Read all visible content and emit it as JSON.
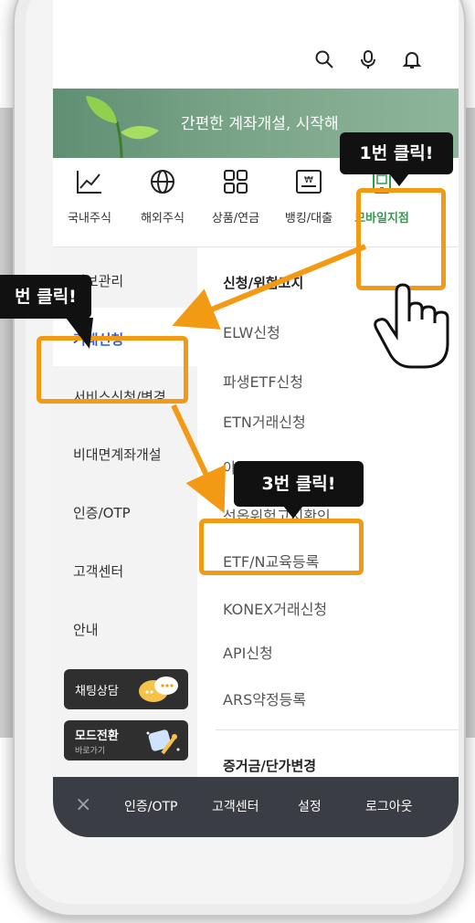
{
  "banner": {
    "text": "간편한 계좌개설, 시작해"
  },
  "top_icons": [
    "search-icon",
    "microphone-icon",
    "bell-icon"
  ],
  "menu": [
    {
      "label": "국내주식",
      "icon": "trend-chart-icon",
      "active": false
    },
    {
      "label": "해외주식",
      "icon": "globe-icon",
      "active": false
    },
    {
      "label": "상품/연금",
      "icon": "grid-icon",
      "active": false
    },
    {
      "label": "뱅킹/대출",
      "icon": "won-card-icon",
      "active": false
    },
    {
      "label": "모바일지점",
      "icon": "mobile-icon",
      "active": true
    }
  ],
  "left_nav": {
    "items": [
      "정보관리",
      "거래신청",
      "서비스신청/변경",
      "비대면계좌개설",
      "인증/OTP",
      "고객센터",
      "안내"
    ],
    "selected": "거래신청",
    "chat_button": "채팅상담",
    "mode_button": {
      "label": "모드전환",
      "sub": "바로가기"
    }
  },
  "right_list": {
    "header": "신청/위험고지",
    "items": [
      "ELW신청",
      "파생ETF신청",
      "ETN거래신청",
      "야",
      "선옵위험고지확인",
      "ETF/N교육등록",
      "KONEX거래신청",
      "API신청",
      "ARS약정등록"
    ],
    "section2_header": "증거금/단가변경"
  },
  "bottom_bar": {
    "close": "×",
    "items": [
      "인증/OTP",
      "고객센터",
      "설정",
      "로그아웃"
    ]
  },
  "callouts": {
    "step1": "1번 클릭!",
    "step2": "번 클릭!",
    "step3": "3번 클릭!"
  },
  "colors": {
    "highlight": "#f39a14",
    "selected_text": "#2c5ae0",
    "active_menu": "#2e9d4a",
    "bottom_bar": "#3b3d44"
  }
}
